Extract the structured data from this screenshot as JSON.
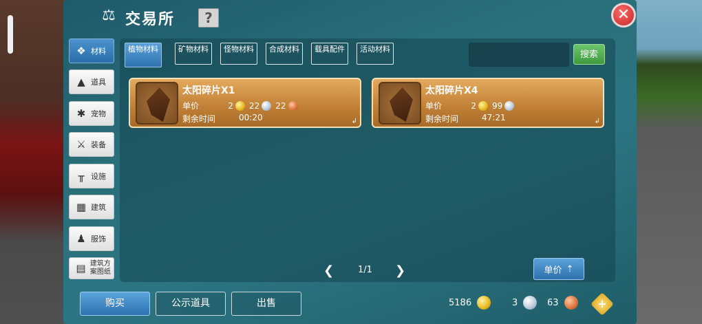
{
  "window": {
    "title": "交易所",
    "help": "?",
    "close": "✕"
  },
  "sidebar": {
    "items": [
      {
        "label": "材料",
        "icon": "ore-icon"
      },
      {
        "label": "道具",
        "icon": "flask-icon"
      },
      {
        "label": "宠物",
        "icon": "paw-icon"
      },
      {
        "label": "装备",
        "icon": "sword-icon"
      },
      {
        "label": "设施",
        "icon": "fence-icon"
      },
      {
        "label": "建筑",
        "icon": "wall-icon"
      },
      {
        "label": "服饰",
        "icon": "shirt-icon"
      },
      {
        "label": "建筑方案图纸",
        "icon": "blueprint-icon"
      }
    ]
  },
  "tabs": [
    {
      "label": "植物材料"
    },
    {
      "label": "矿物材料"
    },
    {
      "label": "怪物材料"
    },
    {
      "label": "合成材料"
    },
    {
      "label": "载具配件"
    },
    {
      "label": "活动材料"
    }
  ],
  "search": {
    "placeholder": "",
    "button": "搜索"
  },
  "listings": [
    {
      "name": "太阳碎片X1",
      "price_label": "单价",
      "gold": "2",
      "silver": "22",
      "copper": "22",
      "time_label": "剩余时间",
      "time": "00:20"
    },
    {
      "name": "太阳碎片X4",
      "price_label": "单价",
      "gold": "2",
      "silver": "99",
      "time_label": "剩余时间",
      "time": "47:21"
    }
  ],
  "pager": {
    "prev": "❮",
    "current": "1/1",
    "next": "❯"
  },
  "sort": {
    "label": "单价"
  },
  "bottom": {
    "buy": "购买",
    "public": "公示道具",
    "sell": "出售"
  },
  "wallet": {
    "gold": "5186",
    "silver": "3",
    "copper": "63"
  },
  "colors": {
    "accent": "#2f72b0",
    "search": "#3f9a3d",
    "close": "#c22626",
    "card": "#c07f35"
  }
}
